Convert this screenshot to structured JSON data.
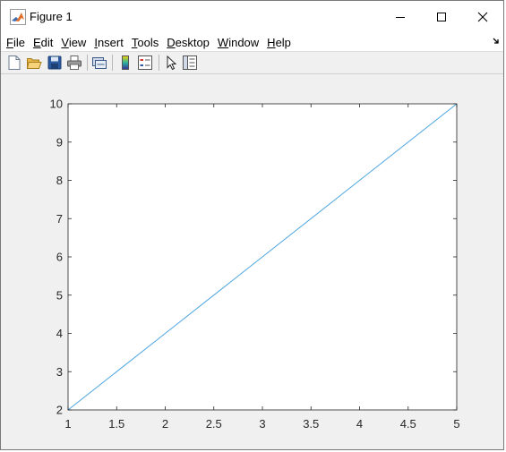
{
  "window": {
    "title": "Figure 1",
    "icons": {
      "app": "matlab-logo-icon",
      "minimize": "minimize-icon",
      "maximize": "maximize-icon",
      "close": "close-icon"
    }
  },
  "menu": {
    "items": [
      {
        "accel": "F",
        "rest": "ile"
      },
      {
        "accel": "E",
        "rest": "dit"
      },
      {
        "accel": "V",
        "rest": "iew"
      },
      {
        "accel": "I",
        "rest": "nsert"
      },
      {
        "accel": "T",
        "rest": "ools"
      },
      {
        "accel": "D",
        "rest": "esktop"
      },
      {
        "accel": "W",
        "rest": "indow"
      },
      {
        "accel": "H",
        "rest": "elp"
      }
    ]
  },
  "toolbar": {
    "tools": [
      "new-figure-icon",
      "open-file-icon",
      "save-icon",
      "print-icon",
      "link-plot-icon",
      "colorbar-icon",
      "legend-icon",
      "edit-plot-arrow-icon",
      "property-inspector-icon"
    ]
  },
  "chart_data": {
    "type": "line",
    "title": "",
    "xlabel": "",
    "ylabel": "",
    "xlim": [
      1,
      5
    ],
    "ylim": [
      2,
      10
    ],
    "xticks": [
      "1",
      "1.5",
      "2",
      "2.5",
      "3",
      "3.5",
      "4",
      "4.5",
      "5"
    ],
    "yticks": [
      "2",
      "3",
      "4",
      "5",
      "6",
      "7",
      "8",
      "9",
      "10"
    ],
    "series": [
      {
        "x": [
          1,
          2,
          3,
          4,
          5
        ],
        "y": [
          2,
          4,
          6,
          8,
          10
        ],
        "color": "#4da6e0"
      }
    ],
    "grid": false
  }
}
